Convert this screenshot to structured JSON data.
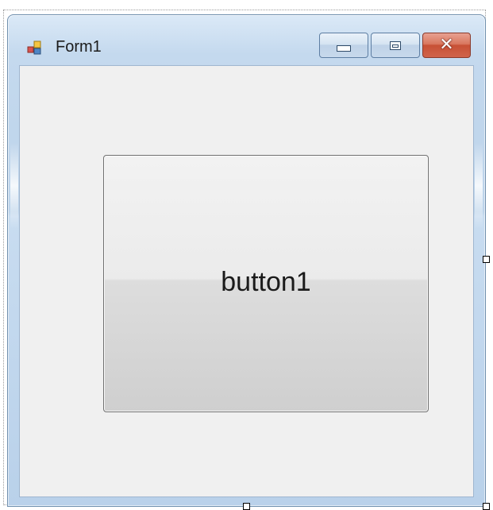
{
  "form": {
    "title": "Form1",
    "icon": "form-app-icon"
  },
  "caption_buttons": {
    "minimize": "minimize-icon",
    "maximize": "maximize-icon",
    "close": "close-icon"
  },
  "controls": {
    "button1_label": "button1"
  },
  "colors": {
    "client_background": "#f0f0f0",
    "frame_blue": "#bcd3ea",
    "close_red": "#c75035"
  }
}
